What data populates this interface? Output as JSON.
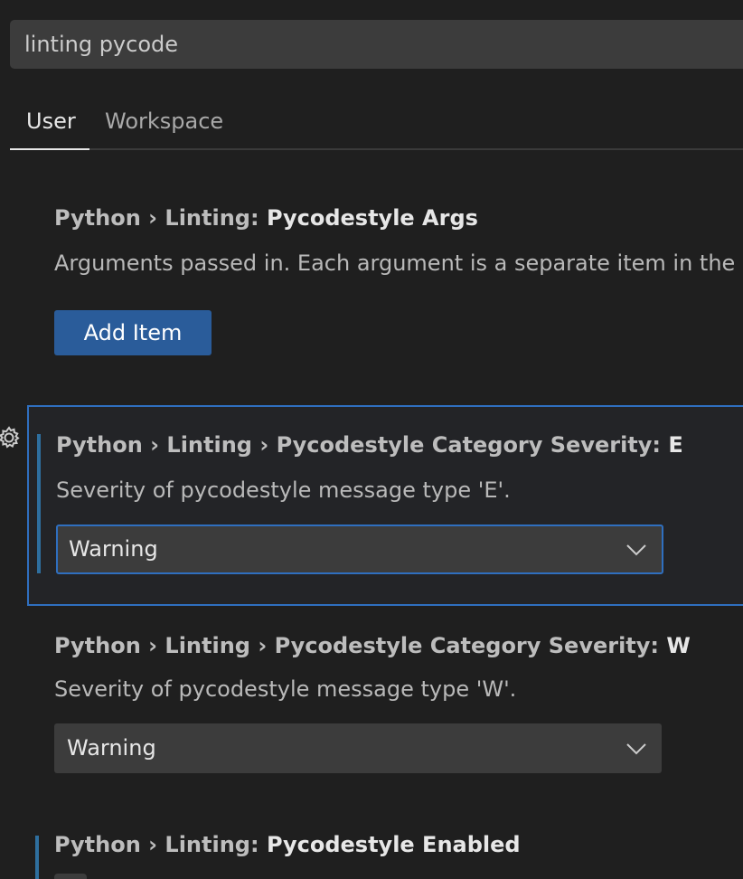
{
  "search": {
    "value": "linting pycode"
  },
  "tabs": [
    {
      "label": "User"
    },
    {
      "label": "Workspace"
    }
  ],
  "settings": [
    {
      "prefix": "Python › Linting: ",
      "leaf": "Pycodestyle Args",
      "description": "Arguments passed in. Each argument is a separate item in the a",
      "button_label": "Add Item"
    },
    {
      "prefix": "Python › Linting › Pycodestyle Category Severity: ",
      "leaf": "E",
      "description": "Severity of pycodestyle message type 'E'.",
      "value": "Warning"
    },
    {
      "prefix": "Python › Linting › Pycodestyle Category Severity: ",
      "leaf": "W",
      "description": "Severity of pycodestyle message type 'W'.",
      "value": "Warning"
    },
    {
      "prefix": "Python › Linting: ",
      "leaf": "Pycodestyle Enabled"
    }
  ],
  "colors": {
    "background": "#1f1f1f",
    "accent_blue": "#2f6fbf",
    "button_blue": "#2a5c9a",
    "modified_bar": "#2e6f9f"
  }
}
